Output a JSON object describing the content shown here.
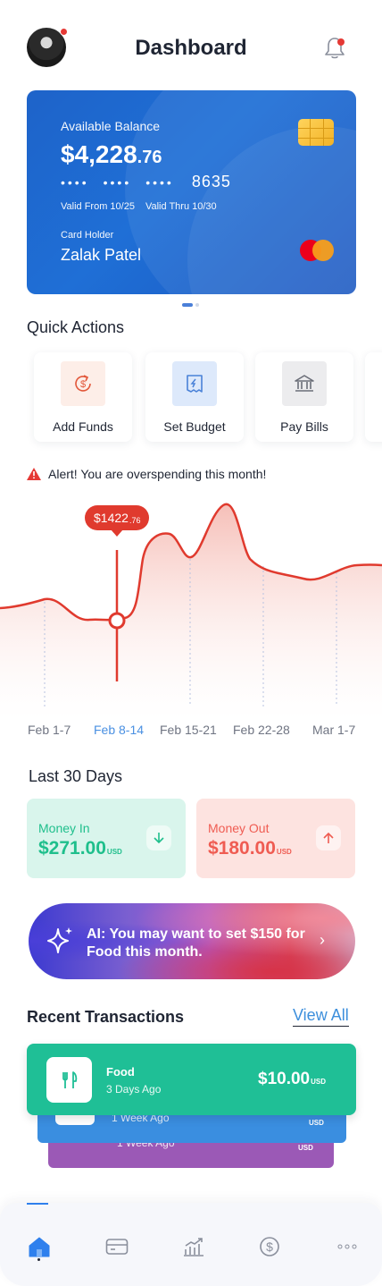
{
  "header": {
    "title": "Dashboard"
  },
  "card": {
    "balance_label": "Available Balance",
    "balance_whole": "$4,228",
    "balance_cents": ".76",
    "number_masked": [
      "••••",
      "••••",
      "••••"
    ],
    "number_last4": "8635",
    "valid_from": "Valid From 10/25",
    "valid_thru": "Valid Thru 10/30",
    "holder_label": "Card Holder",
    "holder_name": "Zalak Patel"
  },
  "quick_actions": {
    "title": "Quick Actions",
    "items": [
      {
        "label": "Add Funds",
        "icon": "dollar-refresh-icon",
        "bg": "#fdeee8",
        "color": "#e2573a"
      },
      {
        "label": "Set Budget",
        "icon": "budget-receipt-icon",
        "bg": "#dde9fb",
        "color": "#4a82d8"
      },
      {
        "label": "Pay Bills",
        "icon": "bank-icon",
        "bg": "#ececee",
        "color": "#6b6e78"
      }
    ]
  },
  "alert": {
    "text": "Alert! You are overspending this month!",
    "icon": "warning-icon",
    "color": "#e53935"
  },
  "chart_data": {
    "type": "area",
    "categories": [
      "Feb 1-7",
      "Feb 8-14",
      "Feb 15-21",
      "Feb 22-28",
      "Mar 1-7"
    ],
    "active_category": "Feb 8-14",
    "tooltip_whole": "$1422",
    "tooltip_cents": ".76",
    "line_color": "#e03a2e",
    "grid": false
  },
  "last30": {
    "title": "Last 30 Days",
    "money_in_label": "Money In",
    "money_in_value": "$271.00",
    "money_in_unit": "USD",
    "money_out_label": "Money Out",
    "money_out_value": "$180.00",
    "money_out_unit": "USD"
  },
  "ai": {
    "text": "AI: You may want to set $150 for Food this month."
  },
  "transactions": {
    "title": "Recent Transactions",
    "view_all": "View All",
    "front": {
      "name": "Food",
      "date": "3 Days Ago",
      "amount": "$10.00",
      "unit": "USD",
      "color": "#1fbf96"
    },
    "back1": {
      "date": "1 Week Ago",
      "unit": "USD",
      "color": "#3a8ee0"
    },
    "back2": {
      "date": "1 Week Ago",
      "unit": "USD",
      "color": "#9b59b6"
    }
  },
  "nav": {
    "items": [
      "home-icon",
      "card-icon",
      "chart-icon",
      "dollar-icon",
      "more-icon"
    ],
    "active": "home-icon"
  }
}
